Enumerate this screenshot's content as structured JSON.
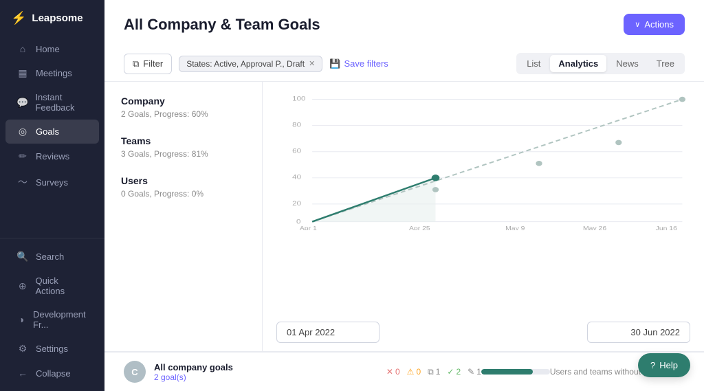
{
  "app": {
    "logo": "Leapsome",
    "logo_icon": "⚡"
  },
  "sidebar": {
    "items": [
      {
        "id": "home",
        "label": "Home",
        "icon": "⌂"
      },
      {
        "id": "meetings",
        "label": "Meetings",
        "icon": "□"
      },
      {
        "id": "instant-feedback",
        "label": "Instant Feedback",
        "icon": "💬"
      },
      {
        "id": "goals",
        "label": "Goals",
        "icon": "◎",
        "active": true
      },
      {
        "id": "reviews",
        "label": "Reviews",
        "icon": "✏"
      },
      {
        "id": "surveys",
        "label": "Surveys",
        "icon": "〜"
      }
    ],
    "bottom_items": [
      {
        "id": "search",
        "label": "Search",
        "icon": "🔍"
      },
      {
        "id": "quick-actions",
        "label": "Quick Actions",
        "icon": "⊕"
      },
      {
        "id": "development",
        "label": "Development Fr...",
        "icon": "◑"
      },
      {
        "id": "settings",
        "label": "Settings",
        "icon": "⚙"
      },
      {
        "id": "collapse",
        "label": "Collapse",
        "icon": "←"
      }
    ]
  },
  "header": {
    "title": "All Company & Team Goals",
    "actions_label": "Actions"
  },
  "filter_bar": {
    "filter_label": "Filter",
    "states_tag": "States: Active, Approval P., Draft",
    "save_filters_label": "Save filters",
    "view_tabs": [
      {
        "id": "list",
        "label": "List"
      },
      {
        "id": "analytics",
        "label": "Analytics",
        "active": true
      },
      {
        "id": "news",
        "label": "News"
      },
      {
        "id": "tree",
        "label": "Tree"
      }
    ]
  },
  "stats": [
    {
      "label": "Company",
      "sub": "2 Goals, Progress: 60%"
    },
    {
      "label": "Teams",
      "sub": "3 Goals, Progress: 81%"
    },
    {
      "label": "Users",
      "sub": "0 Goals, Progress: 0%"
    }
  ],
  "chart": {
    "y_labels": [
      "100",
      "80",
      "60",
      "40",
      "20",
      "0"
    ],
    "x_labels": [
      "Apr 1",
      "Apr 25",
      "May 9",
      "May 26",
      "Jun 16"
    ]
  },
  "date_range": {
    "start": "01 Apr 2022",
    "end": "30 Jun 2022"
  },
  "goal_row": {
    "avatar_letter": "C",
    "name": "All company goals",
    "link": "2 goal(s)",
    "badges": {
      "x": "0",
      "warn": "0",
      "msg": "1",
      "check": "2",
      "edit": "1"
    },
    "progress_pct": 75
  },
  "bottom_info": "Users and teams without goals",
  "help_label": "Help"
}
